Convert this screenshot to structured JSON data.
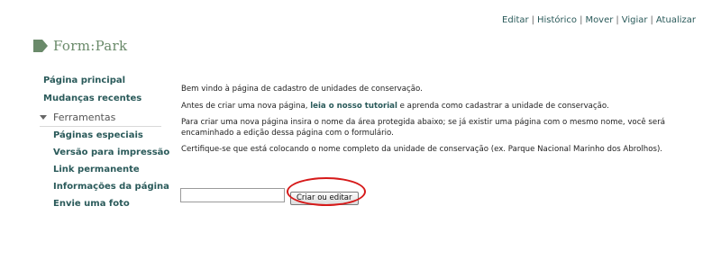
{
  "top_nav": {
    "editar": "Editar",
    "historico": "Histórico",
    "mover": "Mover",
    "vigiar": "Vigiar",
    "atualizar": "Atualizar",
    "separator": "|"
  },
  "page_title": "Form:Park",
  "sidebar": {
    "pagina_principal": "Página principal",
    "mudancas_recentes": "Mudanças recentes",
    "ferramentas": "Ferramentas",
    "tools": [
      "Páginas especiais",
      "Versão para impressão",
      "Link permanente",
      "Informações da página",
      "Envie uma foto"
    ]
  },
  "content": {
    "welcome": "Bem vindo à página de cadastro de unidades de conservação.",
    "p2_before": "Antes de criar uma nova página, ",
    "p2_link": "leia o nosso tutorial",
    "p2_after": " e aprenda como cadastrar a unidade de conservação.",
    "p3": "Para criar uma nova página insira o nome da área protegida abaixo; se já existir uma página com o mesmo nome, você será encaminhado a edição dessa página com o formulário.",
    "p4": "Certifique-se que está colocando o nome completo da unidade de conservação (ex. Parque Nacional Marinho dos Abrolhos)."
  },
  "form": {
    "input_value": "",
    "button_label": "Criar ou editar"
  },
  "colors": {
    "link": "#2a5a5a",
    "title": "#6a8a6a",
    "highlight": "#d61a1a"
  }
}
